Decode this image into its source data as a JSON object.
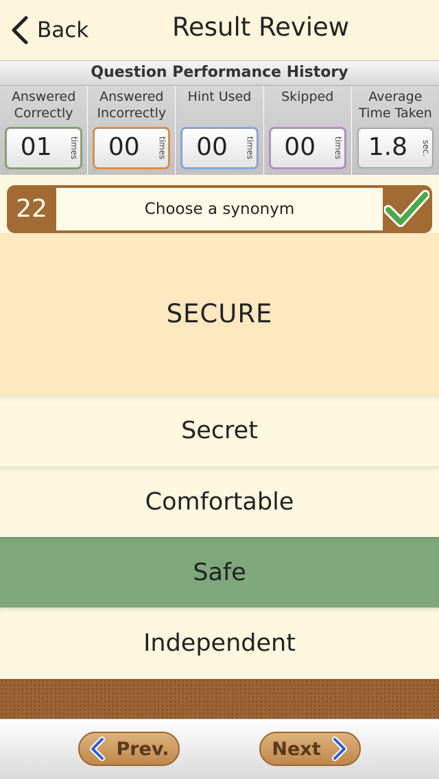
{
  "header": {
    "back_label": "Back",
    "title": "Result Review"
  },
  "stats": {
    "title": "Question Performance History",
    "columns": [
      {
        "label": "Answered Correctly",
        "value": "01",
        "unit": "times",
        "color": "#7aa567"
      },
      {
        "label": "Answered Incorrectly",
        "value": "00",
        "unit": "times",
        "color": "#f08a32"
      },
      {
        "label": "Hint Used",
        "value": "00",
        "unit": "times",
        "color": "#7eaae8"
      },
      {
        "label": "Skipped",
        "value": "00",
        "unit": "times",
        "color": "#b78ad9"
      },
      {
        "label": "Average Time Taken",
        "value": "1.8",
        "unit": "sec.",
        "color": "#bdbdbd"
      }
    ]
  },
  "question": {
    "number": "22",
    "prompt": "Choose a synonym",
    "status_icon": "check-icon"
  },
  "word": "SECURE",
  "options": [
    {
      "label": "Secret",
      "correct": false
    },
    {
      "label": "Comfortable",
      "correct": false
    },
    {
      "label": "Safe",
      "correct": true
    },
    {
      "label": "Independent",
      "correct": false
    }
  ],
  "nav": {
    "prev_label": "Prev.",
    "next_label": "Next"
  },
  "colors": {
    "accent_brown": "#a26b33",
    "correct_green": "#7ea87b",
    "word_bg": "#fde8c0"
  }
}
